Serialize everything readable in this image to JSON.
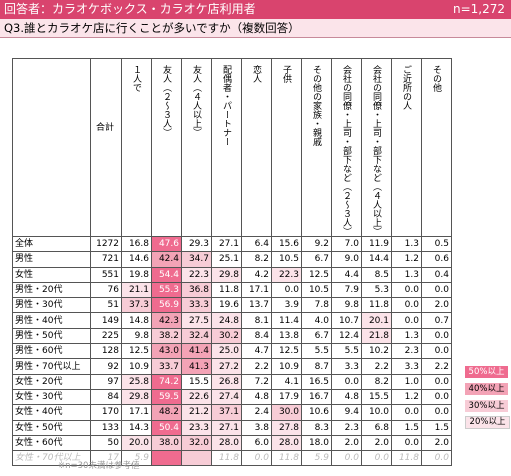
{
  "header": {
    "title": "回答者：カラオケボックス・カラオケ店利用者",
    "n_label": "n=1,272"
  },
  "question": "Q3.誰とカラオケ店に行くことが多いですか（複数回答）",
  "columns": [
    "合計",
    "１人で",
    "友人（２〜３人）",
    "友人（４人以上）",
    "配偶者・パートナー",
    "恋人",
    "子供",
    "その他の家族・親戚",
    "会社の同僚・上司・部下など（２〜３人）",
    "会社の同僚・上司・部下など（４人以上）",
    "ご近所の人",
    "その他"
  ],
  "rows": [
    {
      "label": "全体",
      "values": [
        "1272",
        "16.8",
        "47.6",
        "29.3",
        "27.1",
        "6.4",
        "15.6",
        "9.2",
        "7.0",
        "11.9",
        "1.3",
        "0.5"
      ],
      "levels": [
        0,
        0,
        50,
        0,
        0,
        0,
        0,
        0,
        0,
        0,
        0,
        0
      ]
    },
    {
      "label": "男性",
      "values": [
        "721",
        "14.6",
        "42.4",
        "34.7",
        "25.1",
        "8.2",
        "10.5",
        "6.7",
        "9.0",
        "14.4",
        "1.2",
        "0.6"
      ],
      "levels": [
        0,
        0,
        40,
        30,
        0,
        0,
        0,
        0,
        0,
        0,
        0,
        0
      ]
    },
    {
      "label": "女性",
      "values": [
        "551",
        "19.8",
        "54.4",
        "22.3",
        "29.8",
        "4.2",
        "22.3",
        "12.5",
        "4.4",
        "8.5",
        "1.3",
        "0.4"
      ],
      "levels": [
        0,
        0,
        50,
        20,
        20,
        0,
        20,
        0,
        0,
        0,
        0,
        0
      ]
    },
    {
      "label": "男性・20代",
      "values": [
        "76",
        "21.1",
        "55.3",
        "36.8",
        "11.8",
        "17.1",
        "0.0",
        "10.5",
        "7.9",
        "5.3",
        "0.0",
        "0.0"
      ],
      "levels": [
        0,
        20,
        50,
        30,
        0,
        0,
        0,
        0,
        0,
        0,
        0,
        0
      ]
    },
    {
      "label": "男性・30代",
      "values": [
        "51",
        "37.3",
        "56.9",
        "33.3",
        "19.6",
        "13.7",
        "3.9",
        "7.8",
        "9.8",
        "11.8",
        "0.0",
        "2.0"
      ],
      "levels": [
        0,
        30,
        50,
        30,
        0,
        0,
        0,
        0,
        0,
        0,
        0,
        0
      ]
    },
    {
      "label": "男性・40代",
      "values": [
        "149",
        "14.8",
        "42.3",
        "27.5",
        "24.8",
        "8.1",
        "11.4",
        "4.0",
        "10.7",
        "20.1",
        "0.0",
        "0.7"
      ],
      "levels": [
        0,
        0,
        40,
        20,
        20,
        0,
        0,
        0,
        0,
        20,
        0,
        0
      ]
    },
    {
      "label": "男性・50代",
      "values": [
        "225",
        "9.8",
        "38.2",
        "32.4",
        "30.2",
        "8.4",
        "13.8",
        "6.7",
        "12.4",
        "21.8",
        "1.3",
        "0.0"
      ],
      "levels": [
        0,
        0,
        30,
        30,
        30,
        0,
        0,
        0,
        0,
        20,
        0,
        0
      ]
    },
    {
      "label": "男性・60代",
      "values": [
        "128",
        "12.5",
        "43.0",
        "41.4",
        "25.0",
        "4.7",
        "12.5",
        "5.5",
        "5.5",
        "10.2",
        "2.3",
        "0.0"
      ],
      "levels": [
        0,
        0,
        40,
        40,
        20,
        0,
        0,
        0,
        0,
        0,
        0,
        0
      ]
    },
    {
      "label": "男性・70代以上",
      "values": [
        "92",
        "10.9",
        "33.7",
        "41.3",
        "27.2",
        "2.2",
        "10.9",
        "8.7",
        "3.3",
        "2.2",
        "3.3",
        "2.2"
      ],
      "levels": [
        0,
        0,
        30,
        40,
        20,
        0,
        0,
        0,
        0,
        0,
        0,
        0
      ]
    },
    {
      "label": "女性・20代",
      "values": [
        "97",
        "25.8",
        "74.2",
        "15.5",
        "26.8",
        "7.2",
        "4.1",
        "16.5",
        "0.0",
        "8.2",
        "1.0",
        "0.0"
      ],
      "levels": [
        0,
        20,
        50,
        0,
        20,
        0,
        0,
        0,
        0,
        0,
        0,
        0
      ]
    },
    {
      "label": "女性・30代",
      "values": [
        "84",
        "29.8",
        "59.5",
        "22.6",
        "27.4",
        "4.8",
        "17.9",
        "16.7",
        "4.8",
        "15.5",
        "1.2",
        "0.0"
      ],
      "levels": [
        0,
        20,
        50,
        20,
        20,
        0,
        0,
        0,
        0,
        0,
        0,
        0
      ]
    },
    {
      "label": "女性・40代",
      "values": [
        "170",
        "17.1",
        "48.2",
        "21.2",
        "37.1",
        "2.4",
        "30.0",
        "10.6",
        "9.4",
        "10.0",
        "0.0",
        "0.0"
      ],
      "levels": [
        0,
        0,
        40,
        20,
        30,
        0,
        30,
        0,
        0,
        0,
        0,
        0
      ]
    },
    {
      "label": "女性・50代",
      "values": [
        "133",
        "14.3",
        "50.4",
        "23.3",
        "27.1",
        "3.8",
        "27.8",
        "8.3",
        "2.3",
        "6.8",
        "1.5",
        "1.5"
      ],
      "levels": [
        0,
        0,
        50,
        20,
        20,
        0,
        20,
        0,
        0,
        0,
        0,
        0
      ]
    },
    {
      "label": "女性・60代",
      "values": [
        "50",
        "20.0",
        "38.0",
        "32.0",
        "28.0",
        "6.0",
        "28.0",
        "18.0",
        "2.0",
        "2.0",
        "0.0",
        "2.0"
      ],
      "levels": [
        0,
        20,
        30,
        30,
        20,
        0,
        20,
        0,
        0,
        0,
        0,
        0
      ]
    },
    {
      "label": "女性・70代以上",
      "values": [
        "17",
        "5.9",
        "",
        "",
        "11.8",
        "0.0",
        "11.8",
        "5.9",
        "0.0",
        "0.0",
        "11.8",
        "0.0"
      ],
      "levels": [
        0,
        0,
        50,
        30,
        0,
        0,
        0,
        0,
        0,
        0,
        0,
        0
      ],
      "grey": true
    }
  ],
  "legend": [
    "50%以上",
    "40%以上",
    "30%以上",
    "20%以上"
  ],
  "footnote": "※n=30未満は参考値"
}
